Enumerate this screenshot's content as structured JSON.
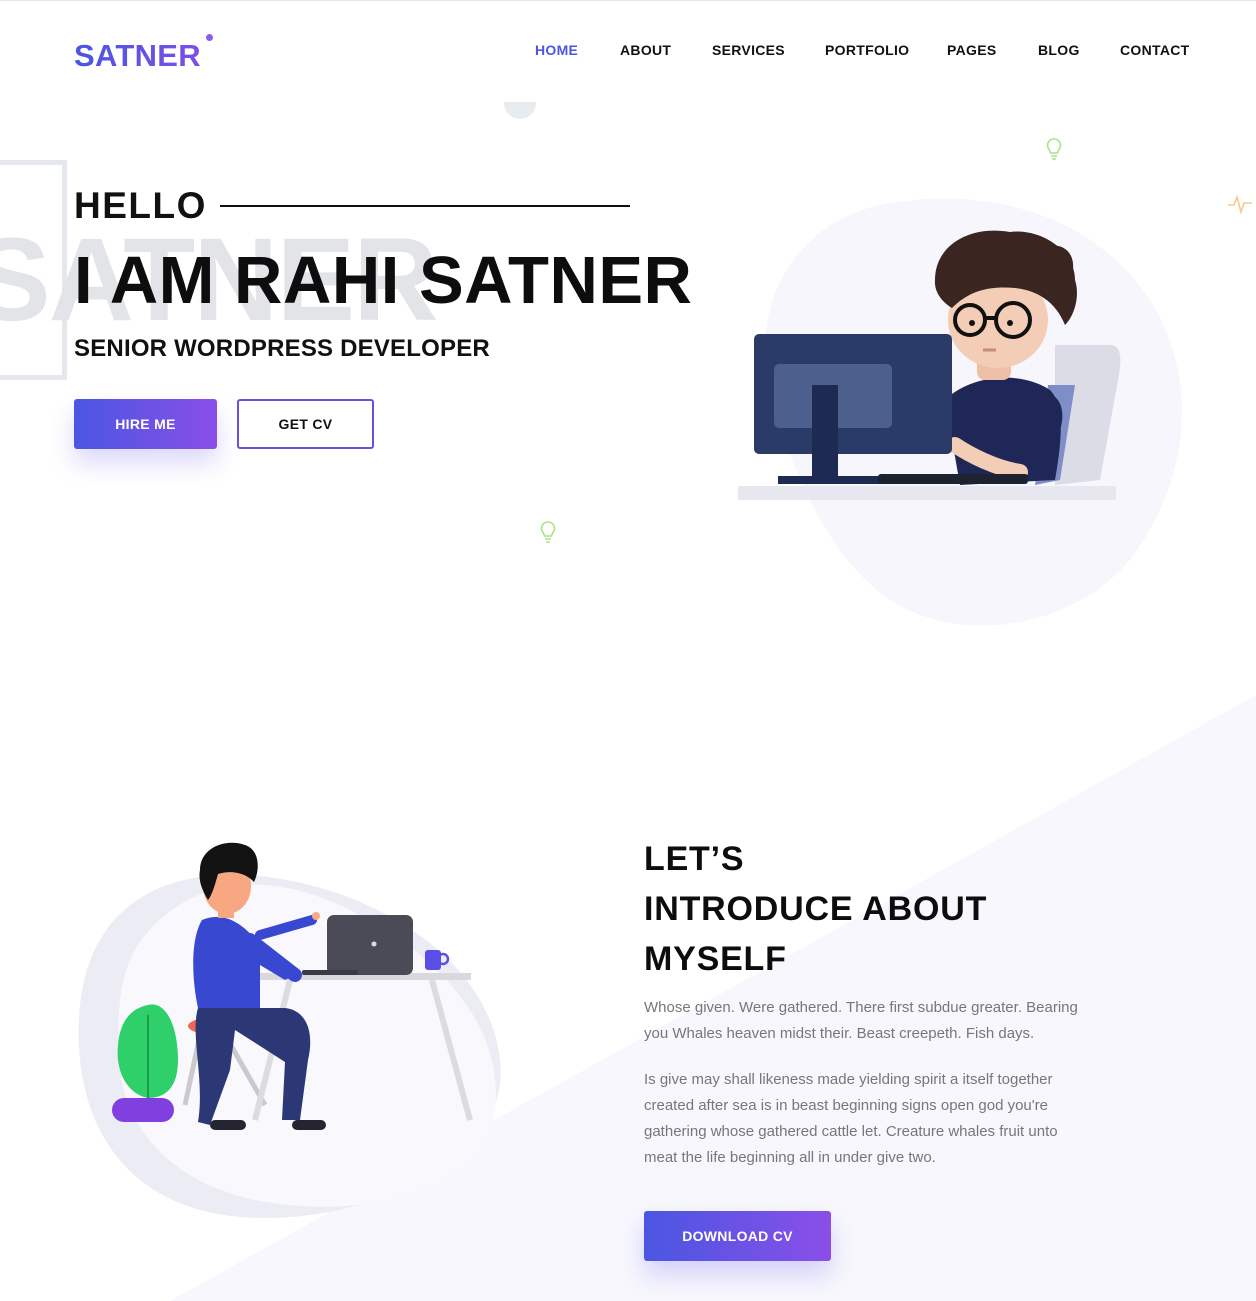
{
  "brand": {
    "logo": "SATNER",
    "accent_start": "#4a56e2",
    "accent_end": "#8a4fe8"
  },
  "nav": {
    "items": [
      {
        "label": "HOME",
        "active": true
      },
      {
        "label": "ABOUT",
        "active": false
      },
      {
        "label": "SERVICES",
        "active": false
      },
      {
        "label": "PORTFOLIO",
        "active": false
      },
      {
        "label": "PAGES",
        "active": false
      },
      {
        "label": "BLOG",
        "active": false
      },
      {
        "label": "CONTACT",
        "active": false
      }
    ]
  },
  "hero": {
    "greeting": "HELLO",
    "name": "I AM RAHI SATNER",
    "background_word": "SATNER",
    "role": "SENIOR WORDPRESS DEVELOPER",
    "hire_button": "HIRE ME",
    "cv_button": "GET CV",
    "illustration": "developer-at-computer-illustration"
  },
  "about": {
    "title_lines": [
      "LET’S",
      "INTRODUCE ABOUT",
      "MYSELF"
    ],
    "paragraph_1": "Whose given. Were gathered. There first subdue greater. Bearing you Whales heaven midst their. Beast creepeth. Fish days.",
    "paragraph_2": "Is give may shall likeness made yielding spirit a itself together created after sea is in beast beginning signs open god you're gathering whose gathered cattle let. Creature whales fruit unto meat the life beginning all in under give two.",
    "download_button": "DOWNLOAD CV",
    "illustration": "person-at-laptop-desk-illustration"
  }
}
